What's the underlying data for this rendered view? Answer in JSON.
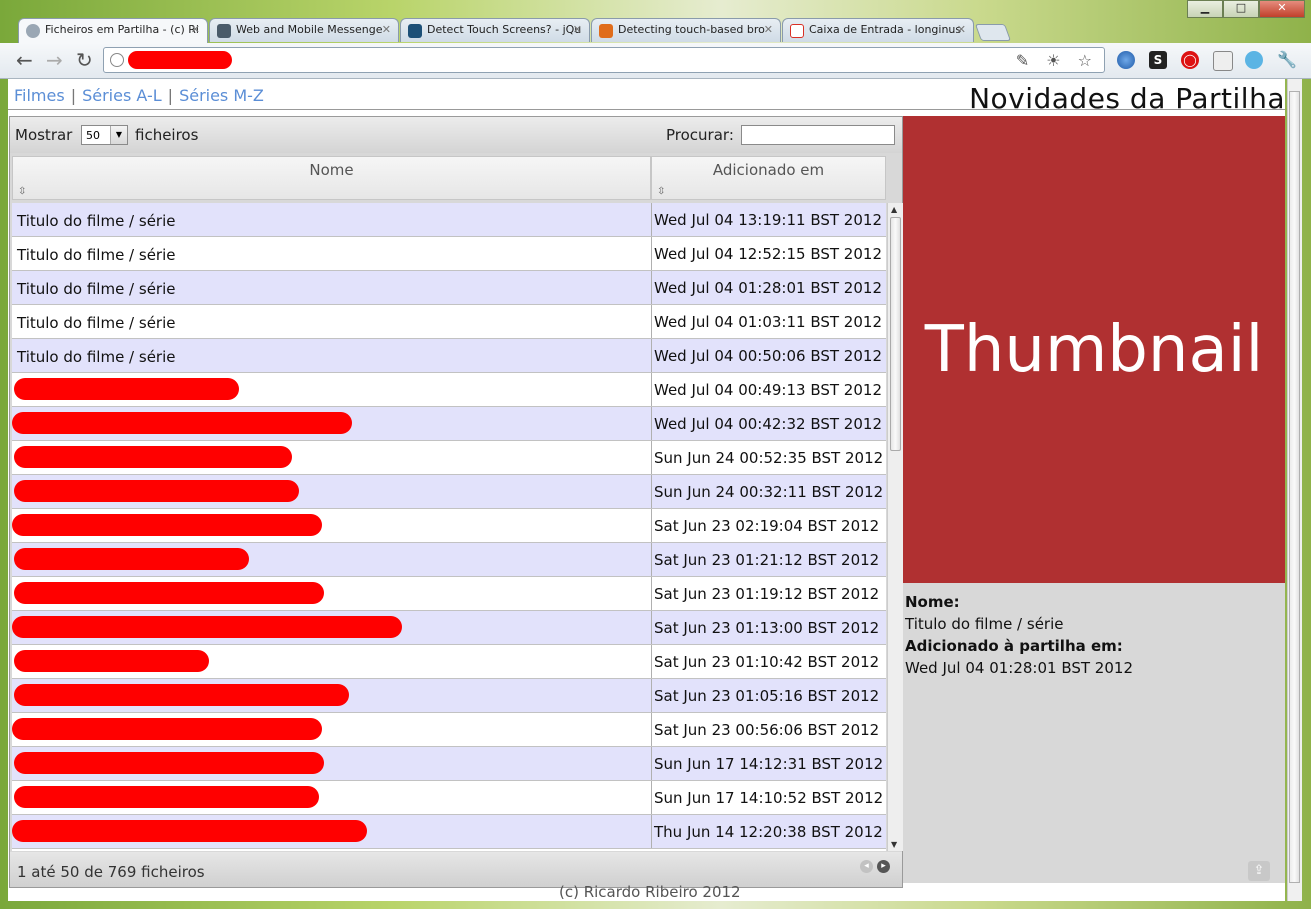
{
  "browser": {
    "window_controls": [
      "▁",
      "□",
      "✕"
    ],
    "tabs": [
      {
        "title": "Ficheiros em Partilha - (c) Ri",
        "favicon_color": "#9aa7b4",
        "close": "✕"
      },
      {
        "title": "Web and Mobile Messenge",
        "favicon_color": "#4a5b6a",
        "close": "✕"
      },
      {
        "title": "Detect Touch Screens? - jQu",
        "favicon_color": "#1d5077",
        "close": "✕"
      },
      {
        "title": "Detecting touch-based bro",
        "favicon_color": "#e06c1a",
        "close": "✕"
      },
      {
        "title": "Caixa de Entrada - longinus",
        "favicon_color": "#d93025",
        "close": "✕"
      }
    ],
    "nav": {
      "back": "←",
      "forward": "→",
      "reload": "↻"
    },
    "omnibox_icons": "✎ ☀ ☆"
  },
  "header": {
    "nav_links": [
      "Filmes",
      "Séries A-L",
      "Séries M-Z"
    ],
    "separator": "|",
    "title": "Novidades da Partilha"
  },
  "controls": {
    "show_label": "Mostrar",
    "page_size": "50",
    "files_label": "ficheiros",
    "search_label": "Procurar:",
    "search_value": ""
  },
  "table": {
    "columns": [
      "Nome",
      "Adicionado em"
    ],
    "sort_icon": "⇳",
    "rows": [
      {
        "name": "Titulo do filme / série",
        "date": "Wed Jul 04 13:19:11 BST 2012"
      },
      {
        "name": "Titulo do filme / série",
        "date": "Wed Jul 04 12:52:15 BST 2012"
      },
      {
        "name": "Titulo do filme / série",
        "date": "Wed Jul 04 01:28:01 BST 2012"
      },
      {
        "name": "Titulo do filme / série",
        "date": "Wed Jul 04 01:03:11 BST 2012"
      },
      {
        "name": "Titulo do filme / série",
        "date": "Wed Jul 04 00:50:06 BST 2012"
      },
      {
        "name": "",
        "date": "Wed Jul 04 00:49:13 BST 2012"
      },
      {
        "name": "",
        "date": "Wed Jul 04 00:42:32 BST 2012"
      },
      {
        "name": "",
        "date": "Sun Jun 24 00:52:35 BST 2012"
      },
      {
        "name": "",
        "date": "Sun Jun 24 00:32:11 BST 2012"
      },
      {
        "name": "",
        "date": "Sat Jun 23 02:19:04 BST 2012"
      },
      {
        "name": "",
        "date": "Sat Jun 23 01:21:12 BST 2012"
      },
      {
        "name": "",
        "date": "Sat Jun 23 01:19:12 BST 2012"
      },
      {
        "name": "",
        "date": "Sat Jun 23 01:13:00 BST 2012"
      },
      {
        "name": "",
        "date": "Sat Jun 23 01:10:42 BST 2012"
      },
      {
        "name": "",
        "date": "Sat Jun 23 01:05:16 BST 2012"
      },
      {
        "name": "",
        "date": "Sat Jun 23 00:56:06 BST 2012"
      },
      {
        "name": "",
        "date": "Sun Jun 17 14:12:31 BST 2012"
      },
      {
        "name": "",
        "date": "Sun Jun 17 14:10:52 BST 2012"
      },
      {
        "name": "",
        "date": "Thu Jun 14 12:20:38 BST 2012"
      }
    ],
    "info": "1 até 50 de 769 ficheiros",
    "prev": "◂",
    "next": "▸"
  },
  "details": {
    "thumbnail_text": "Thumbnail",
    "name_label": "Nome:",
    "name_value": "Titulo do filme / série",
    "added_label": "Adicionado à partilha em:",
    "added_value": "Wed Jul 04 01:28:01 BST 2012"
  },
  "footer": {
    "credit": "(c) Ricardo Ribeiro 2012"
  },
  "colors": {
    "link": "#5b8ed6",
    "odd_row": "#e2e2fb",
    "thumbnail_bg": "#b03031",
    "redaction": "#ff0000"
  }
}
